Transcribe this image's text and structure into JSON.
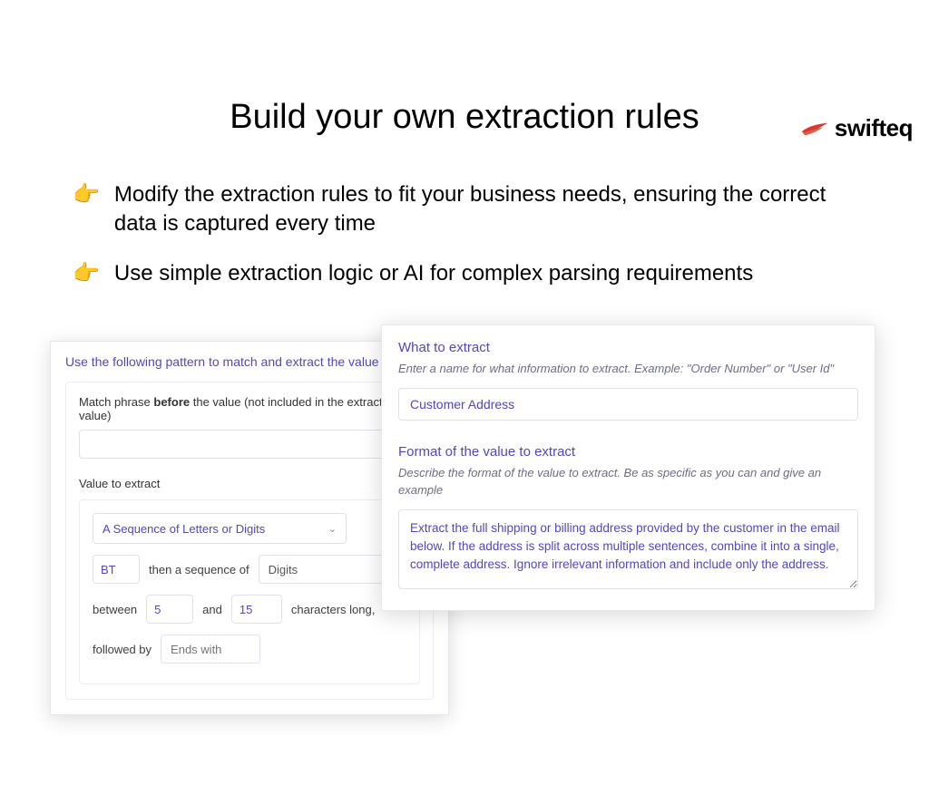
{
  "logo": {
    "text": "swifteq"
  },
  "title": "Build your own extraction rules",
  "bullets": [
    "Modify the extraction rules to fit your business needs, ensuring the correct data is captured every time",
    "Use simple extraction logic or AI for complex parsing requirements"
  ],
  "leftCard": {
    "title": "Use the following pattern to match and extract the value",
    "matchLabelPrefix": "Match phrase ",
    "matchLabelBold": "before",
    "matchLabelSuffix": " the value (not included in the extracted value)",
    "valueLabel": "Value to extract",
    "sequenceType": "A Sequence of Letters or Digits",
    "prefix": "BT",
    "thenText": "then a sequence of",
    "digitsValue": "Digits",
    "betweenText": "between",
    "minVal": "5",
    "andText": "and",
    "maxVal": "15",
    "charsText": "characters long,",
    "followedText": "followed by",
    "endsPlaceholder": "Ends with"
  },
  "rightCard": {
    "whatHeading": "What to extract",
    "whatSub": "Enter a name for what information to extract. Example: \"Order Number\" or \"User Id\"",
    "nameValue": "Customer Address",
    "formatHeading": "Format of the value to extract",
    "formatSub": "Describe the format of the value to extract. Be as specific as you can and give an example",
    "formatValue": "Extract the full shipping or billing address provided by the customer in the email below. If the address is split across multiple sentences, combine it into a single, complete address. Ignore irrelevant information and include only the address."
  }
}
